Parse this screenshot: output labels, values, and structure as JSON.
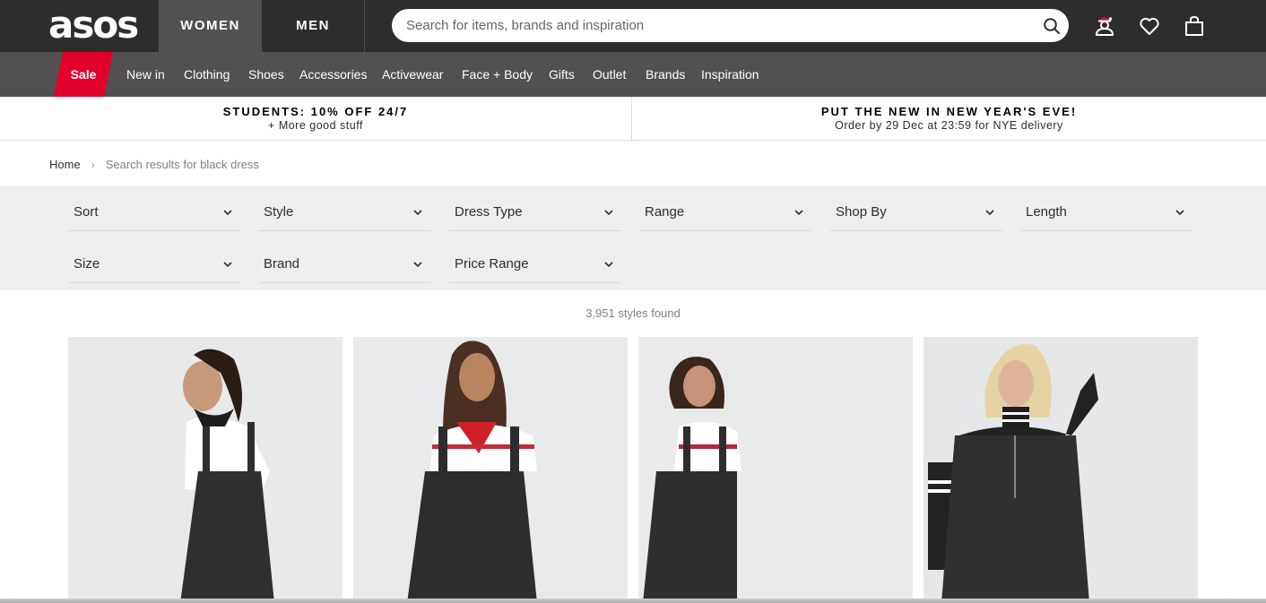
{
  "header": {
    "logo": "asos",
    "gender_tabs": [
      "WOMEN",
      "MEN"
    ],
    "search_placeholder": "Search for items, brands and inspiration",
    "icons": [
      "search-icon",
      "account-icon",
      "wishlist-heart-icon",
      "bag-icon"
    ]
  },
  "nav": {
    "sale": "Sale",
    "items": [
      "New in",
      "Clothing",
      "Shoes",
      "Accessories",
      "Activewear",
      "Face + Body",
      "Gifts",
      "Outlet",
      "Brands",
      "Inspiration"
    ],
    "sale_color": "#e1002a"
  },
  "promos": [
    {
      "title": "STUDENTS: 10% OFF 24/7",
      "subtitle": "+ More good stuff"
    },
    {
      "title": "PUT THE NEW IN NEW YEAR'S EVE!",
      "subtitle": "Order by 29 Dec at 23:59 for NYE delivery"
    }
  ],
  "breadcrumb": {
    "home": "Home",
    "separator": "›",
    "current": "Search results for black dress"
  },
  "filters": [
    "Sort",
    "Style",
    "Dress Type",
    "Range",
    "Shop By",
    "Length",
    "Size",
    "Brand",
    "Price Range"
  ],
  "results": {
    "count_text": "3,951 styles found"
  },
  "products": [
    {
      "image": "black denim pinafore dress with white t-shirt and bandana"
    },
    {
      "image": "black denim dungaree dress with striped t-shirt and red neckerchief"
    },
    {
      "image": "black denim pinafore dress with striped t-shirt"
    },
    {
      "image": "black denim dress with zip front and striped-sleeve top"
    }
  ],
  "colors": {
    "topbar": "#2d2d2d",
    "navbar": "#525050",
    "sale": "#e1002a",
    "filter_bg": "#eeeeee"
  }
}
